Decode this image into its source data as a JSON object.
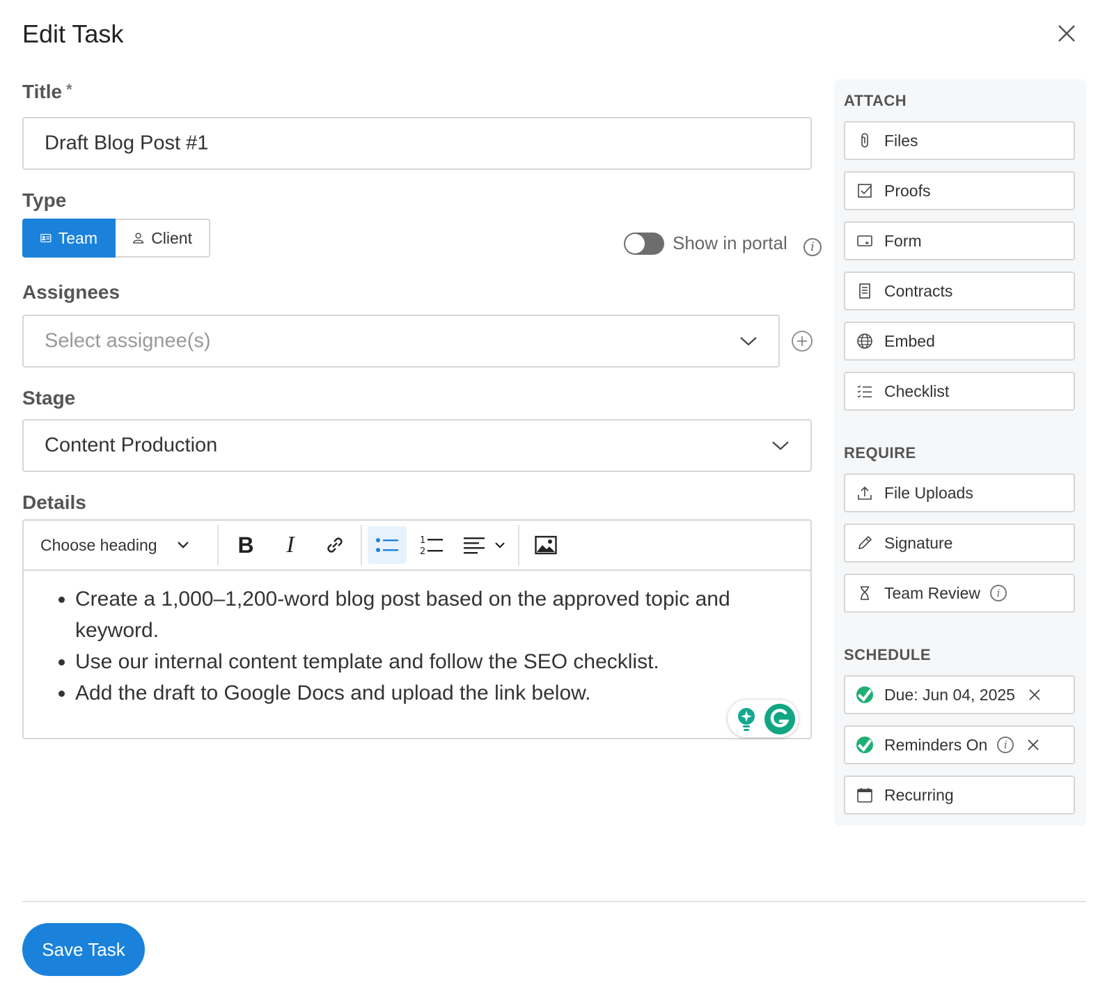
{
  "dialog": {
    "title": "Edit Task"
  },
  "form": {
    "title_label": "Title",
    "required_mark": "*",
    "title_value": "Draft Blog Post #1",
    "type_label": "Type",
    "type_options": [
      "Team",
      "Client"
    ],
    "type_selected": "Team",
    "portal_toggle_label": "Show in portal",
    "portal_toggle_on": false,
    "assignees_label": "Assignees",
    "assignees_placeholder": "Select assignee(s)",
    "stage_label": "Stage",
    "stage_value": "Content Production",
    "details_label": "Details"
  },
  "editor": {
    "heading_select": "Choose heading",
    "bullets": [
      "Create a 1,000–1,200-word blog post based on the approved topic and keyword.",
      "Use our internal content template and follow the SEO checklist.",
      "Add the draft to Google Docs and upload the link below."
    ]
  },
  "sidebar": {
    "attach": {
      "heading": "ATTACH",
      "items": [
        {
          "label": "Files",
          "icon": "paperclip-icon"
        },
        {
          "label": "Proofs",
          "icon": "checkbox-icon"
        },
        {
          "label": "Form",
          "icon": "form-icon"
        },
        {
          "label": "Contracts",
          "icon": "document-icon"
        },
        {
          "label": "Embed",
          "icon": "globe-icon"
        },
        {
          "label": "Checklist",
          "icon": "checklist-icon"
        }
      ]
    },
    "require": {
      "heading": "REQUIRE",
      "items": [
        {
          "label": "File Uploads",
          "icon": "upload-icon"
        },
        {
          "label": "Signature",
          "icon": "pen-icon"
        },
        {
          "label": "Team Review",
          "icon": "hourglass-icon"
        }
      ]
    },
    "schedule": {
      "heading": "SCHEDULE",
      "items": [
        {
          "label": "Due: Jun 04, 2025",
          "icon": "check-circle-icon"
        },
        {
          "label": "Reminders On",
          "icon": "check-circle-icon"
        },
        {
          "label": "Recurring",
          "icon": "calendar-icon"
        }
      ]
    }
  },
  "footer": {
    "save_label": "Save Task"
  },
  "colors": {
    "primary": "#1a82db",
    "success": "#1fae78",
    "toggle_off": "#6d6d6d"
  }
}
